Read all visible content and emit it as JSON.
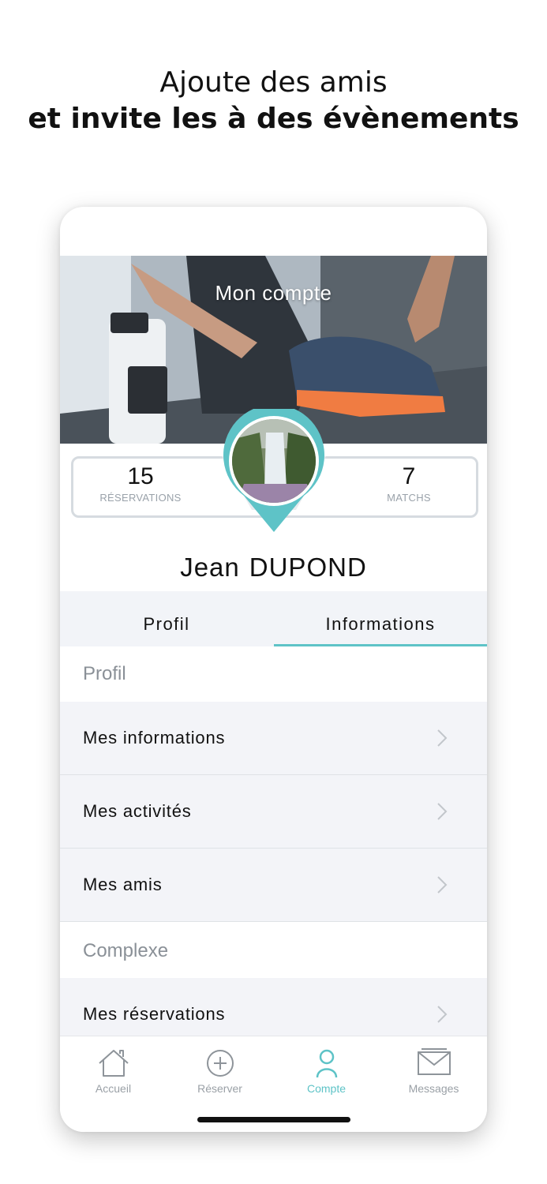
{
  "headline": {
    "line1": "Ajoute des amis",
    "line2": "et invite les à des évènements"
  },
  "hero": {
    "title": "Mon compte"
  },
  "stats": {
    "reservations": {
      "value": "15",
      "label": "RÉSERVATIONS"
    },
    "matchs": {
      "value": "7",
      "label": "MATCHS"
    }
  },
  "user": {
    "first_name": "Jean",
    "last_name": "DUPOND"
  },
  "tabs": [
    {
      "label": "Profil",
      "active": false
    },
    {
      "label": "Informations",
      "active": true
    }
  ],
  "sections": {
    "profil": {
      "title": "Profil",
      "items": [
        "Mes informations",
        "Mes activités",
        "Mes amis"
      ]
    },
    "complexe": {
      "title": "Complexe",
      "items": [
        "Mes réservations"
      ]
    }
  },
  "tabbar": [
    {
      "label": "Accueil",
      "icon": "home-icon",
      "active": false
    },
    {
      "label": "Réserver",
      "icon": "plus-circle-icon",
      "active": false
    },
    {
      "label": "Compte",
      "icon": "user-icon",
      "active": true
    },
    {
      "label": "Messages",
      "icon": "mail-icon",
      "active": false
    }
  ],
  "colors": {
    "accent": "#5ec3c7",
    "row_bg": "#f3f4f8",
    "muted": "#9aa0a6"
  }
}
